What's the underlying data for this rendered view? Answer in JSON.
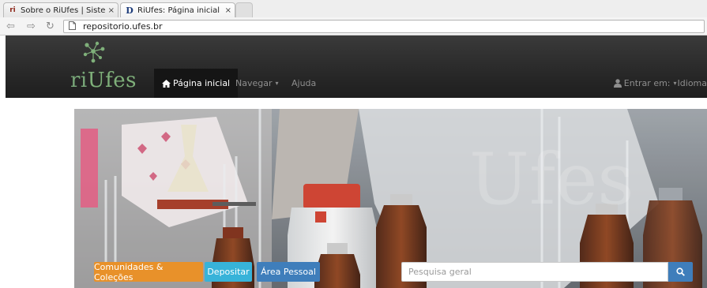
{
  "browser": {
    "tabs": [
      {
        "title": "Sobre o RiUfes | Sistema I",
        "favicon": "ri-favicon-icon",
        "close": "×",
        "active": false
      },
      {
        "title": "RiUfes: Página inicial",
        "favicon": "dspace-favicon-icon",
        "close": "×",
        "active": true
      }
    ],
    "favicon_labels": [
      "ri",
      "D"
    ],
    "url": "repositorio.ufes.br"
  },
  "site": {
    "logo": {
      "ri": "ri",
      "ufes": "Ufes"
    },
    "nav": {
      "home": "Página inicial",
      "browse": "Navegar",
      "help": "Ajuda",
      "login": "Entrar em:",
      "language": "Idioma"
    },
    "hero": {
      "buttons": {
        "communities": "Comunidades & Coleções",
        "deposit": "Depositar",
        "personal": "Área Pessoal"
      },
      "search_placeholder": "Pesquisa geral"
    }
  },
  "colors": {
    "navbar": "#2a2a2a",
    "logo_green": "#7fb07a",
    "orange": "#e8912a",
    "cyan": "#37b3d9",
    "blue": "#3f7ebb"
  }
}
